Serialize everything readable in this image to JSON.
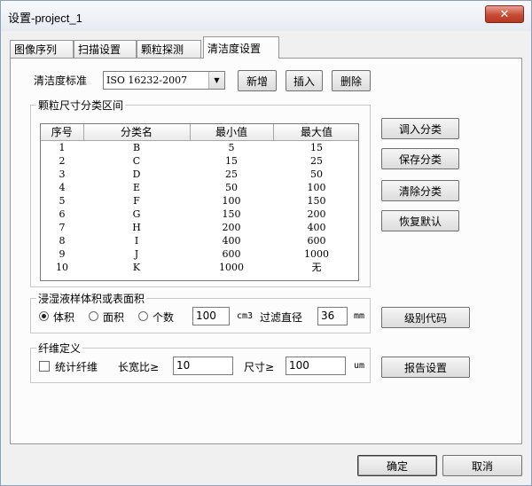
{
  "window": {
    "title": "设置-project_1",
    "close_glyph": "✕"
  },
  "tabs": [
    {
      "label": "图像序列"
    },
    {
      "label": "扫描设置"
    },
    {
      "label": "颗粒探测"
    },
    {
      "label": "清洁度设置"
    }
  ],
  "standard": {
    "label": "清洁度标准",
    "selected": "ISO 16232-2007",
    "add_label": "新增",
    "insert_label": "插入",
    "delete_label": "删除"
  },
  "size_classes": {
    "group_title": "颗粒尺寸分类区间",
    "headers": [
      "序号",
      "分类名",
      "最小值",
      "最大值"
    ],
    "rows": [
      [
        "1",
        "B",
        "5",
        "15"
      ],
      [
        "2",
        "C",
        "15",
        "25"
      ],
      [
        "3",
        "D",
        "25",
        "50"
      ],
      [
        "4",
        "E",
        "50",
        "100"
      ],
      [
        "5",
        "F",
        "100",
        "150"
      ],
      [
        "6",
        "G",
        "150",
        "200"
      ],
      [
        "7",
        "H",
        "200",
        "400"
      ],
      [
        "8",
        "I",
        "400",
        "600"
      ],
      [
        "9",
        "J",
        "600",
        "1000"
      ],
      [
        "10",
        "K",
        "1000",
        "无"
      ]
    ],
    "load_label": "调入分类",
    "save_label": "保存分类",
    "clear_label": "清除分类",
    "restore_label": "恢复默认"
  },
  "volume": {
    "group_title": "浸湿液样体积或表面积",
    "option_volume": "体积",
    "option_area": "面积",
    "option_count": "个数",
    "selected": "体积",
    "value": "100",
    "unit": "cm3",
    "filter_label": "过滤直径",
    "filter_value": "36",
    "filter_unit": "mm",
    "level_code_label": "级别代码"
  },
  "fiber": {
    "group_title": "纤维定义",
    "count_fiber_label": "统计纤维",
    "count_fiber_checked": false,
    "aspect_label": "长宽比≥",
    "aspect_value": "10",
    "size_label": "尺寸≥",
    "size_value": "100",
    "size_unit": "um",
    "report_label": "报告设置"
  },
  "footer": {
    "ok_label": "确定",
    "cancel_label": "取消"
  },
  "colors": {
    "close_button": "#c64b35",
    "panel": "#fcfcfc",
    "dialog": "#f0f0f0"
  }
}
